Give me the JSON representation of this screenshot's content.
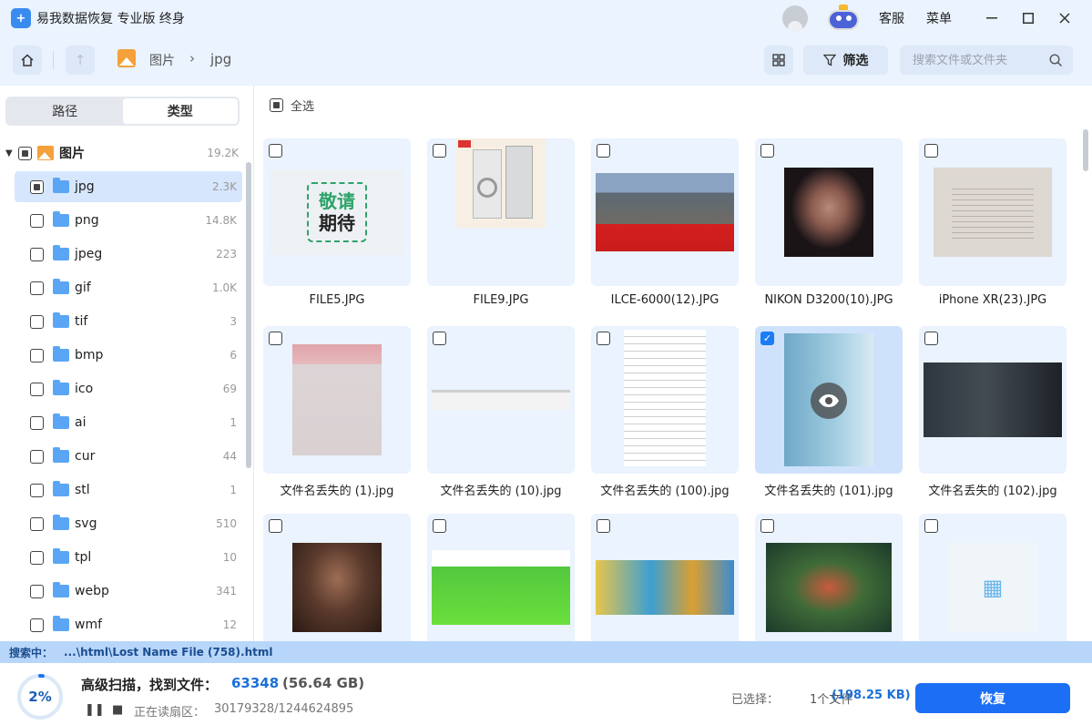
{
  "app": {
    "logo_glyph": "+",
    "title": "易我数据恢复 专业版 终身",
    "customer_service": "客服",
    "menu": "菜单"
  },
  "nav": {
    "crumb_root": "图片",
    "crumb_sep": "›",
    "crumb_current": "jpg",
    "filter_label": "筛选",
    "search_placeholder": "搜索文件或文件夹",
    "up_glyph": "↑"
  },
  "sidebar": {
    "tab_path": "路径",
    "tab_type": "类型",
    "root": {
      "label": "图片",
      "count": "19.2K"
    },
    "items": [
      {
        "label": "jpg",
        "count": "2.3K"
      },
      {
        "label": "png",
        "count": "14.8K"
      },
      {
        "label": "jpeg",
        "count": "223"
      },
      {
        "label": "gif",
        "count": "1.0K"
      },
      {
        "label": "tif",
        "count": "3"
      },
      {
        "label": "bmp",
        "count": "6"
      },
      {
        "label": "ico",
        "count": "69"
      },
      {
        "label": "ai",
        "count": "1"
      },
      {
        "label": "cur",
        "count": "44"
      },
      {
        "label": "stl",
        "count": "1"
      },
      {
        "label": "svg",
        "count": "510"
      },
      {
        "label": "tpl",
        "count": "10"
      },
      {
        "label": "webp",
        "count": "341"
      },
      {
        "label": "wmf",
        "count": "12"
      }
    ]
  },
  "content": {
    "select_all": "全选",
    "files": [
      {
        "name": "FILE5.JPG",
        "thumb_text_1": "敬请",
        "thumb_text_2": "期待"
      },
      {
        "name": "FILE9.JPG"
      },
      {
        "name": "ILCE-6000(12).JPG"
      },
      {
        "name": "NIKON D3200(10).JPG"
      },
      {
        "name": "iPhone XR(23).JPG"
      },
      {
        "name": "文件名丢失的 (1).jpg"
      },
      {
        "name": "文件名丢失的 (10).jpg"
      },
      {
        "name": "文件名丢失的 (100).jpg"
      },
      {
        "name": "文件名丢失的 (101).jpg",
        "checked": true
      },
      {
        "name": "文件名丢失的 (102).jpg"
      },
      {
        "name": ""
      },
      {
        "name": ""
      },
      {
        "name": ""
      },
      {
        "name": ""
      },
      {
        "name": ""
      }
    ]
  },
  "status": {
    "label": "搜索中：",
    "path": "...\\html\\Lost Name File (758).html"
  },
  "bottom": {
    "percent": "2%",
    "progress_fraction": 0.02,
    "scan_title": "高级扫描，找到文件：",
    "found_count": "63348",
    "found_size": "(56.64 GB)",
    "pause_glyph": "❚❚",
    "stop_glyph": "■",
    "reading_label": "正在读扇区：",
    "sector": "30179328/1244624895",
    "selected_label": "已选择：",
    "selected_value": "1个文件",
    "selected_size": "(198.25 KB)",
    "recover": "恢复"
  },
  "colors": {
    "accent": "#1c6ff4",
    "titlebar_bg": "#eaf3fe",
    "status_bg": "#b8d6fa"
  }
}
